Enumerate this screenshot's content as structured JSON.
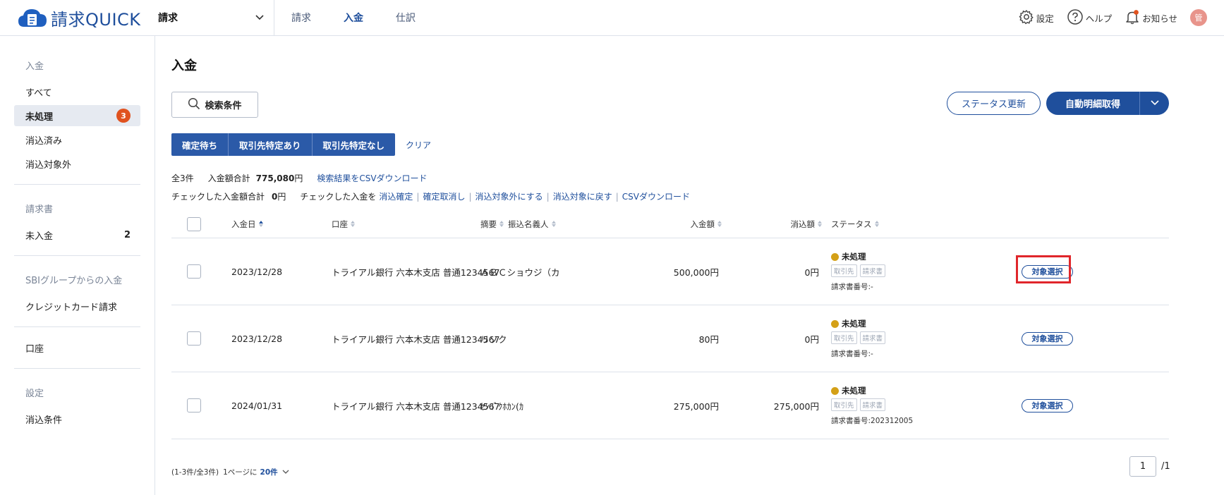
{
  "header": {
    "logo_text": "請求QUICK",
    "product_select": "請求",
    "nav": [
      "請求",
      "入金",
      "仕訳"
    ],
    "active_nav": 1,
    "settings": "設定",
    "help": "ヘルプ",
    "notices": "お知らせ",
    "avatar": "管",
    "colors": {
      "accent": "#1f4f9c",
      "notice_dot": "#e0521f",
      "avatar_bg": "#e8948b"
    }
  },
  "sidebar": {
    "sections": [
      {
        "heading": "入金",
        "items": [
          {
            "label": "すべて"
          },
          {
            "label": "未処理",
            "badge": "3",
            "active": true
          },
          {
            "label": "消込済み"
          },
          {
            "label": "消込対象外"
          }
        ]
      },
      {
        "heading": "請求書",
        "items": [
          {
            "label": "未入金",
            "count": "2"
          }
        ]
      },
      {
        "heading": "SBIグループからの入金",
        "items": [
          {
            "label": "クレジットカード請求"
          }
        ]
      },
      {
        "heading": "",
        "items": [
          {
            "label": "口座"
          }
        ]
      },
      {
        "heading": "設定",
        "items": [
          {
            "label": "消込条件"
          }
        ]
      }
    ]
  },
  "main": {
    "title": "入金",
    "search_button": "検索条件",
    "status_update_button": "ステータス更新",
    "auto_fetch_button": "自動明細取得",
    "filter_tabs": [
      "確定待ち",
      "取引先特定あり",
      "取引先特定なし"
    ],
    "clear": "クリア",
    "summary": {
      "total_count": "全3件",
      "amount_label": "入金額合計",
      "amount_value": "775,080",
      "yen": "円",
      "csv_link": "検索結果をCSVダウンロード",
      "checked_label": "チェックした入金額合計",
      "checked_value": "0",
      "checked_action_label": "チェックした入金を",
      "actions": [
        "消込確定",
        "確定取消し",
        "消込対象外にする",
        "消込対象に戻す",
        "CSVダウンロード"
      ]
    },
    "table": {
      "columns": {
        "date": "入金日",
        "account": "口座",
        "memo": "摘要",
        "payer": "振込名義人",
        "amount": "入金額",
        "cleared": "消込額",
        "status": "ステータス"
      },
      "rows": [
        {
          "date": "2023/12/28",
          "account": "トライアル銀行 六本木支店 普通1234567",
          "payer": "ＡＢＣショウジ（カ",
          "amount": "500,000円",
          "cleared": "0円",
          "status": "未処理",
          "tags": [
            "取引先",
            "請求書"
          ],
          "invoice_no": "請求書番号:-",
          "action": "対象選択"
        },
        {
          "date": "2023/12/28",
          "account": "トライアル銀行 六本木支店 普通1234567",
          "payer": "リソク",
          "amount": "80円",
          "cleared": "0円",
          "status": "未処理",
          "tags": [
            "取引先",
            "請求書"
          ],
          "invoice_no": "請求書番号:-",
          "action": "対象選択"
        },
        {
          "date": "2024/01/31",
          "account": "トライアル銀行 六本木支店 普通1234567",
          "payer": "ｾﾝｺﾞｸﾎｶﾝ(ｶ",
          "amount": "275,000円",
          "cleared": "275,000円",
          "status": "未処理",
          "tags": [
            "取引先",
            "請求書"
          ],
          "invoice_no": "請求書番号:202312005",
          "action": "対象選択"
        }
      ]
    },
    "footer": {
      "range": "(1-3件/全3件)",
      "per_page_label": "1ページに",
      "per_page_value": "20件",
      "page_value": "1",
      "page_total": "/1"
    }
  }
}
